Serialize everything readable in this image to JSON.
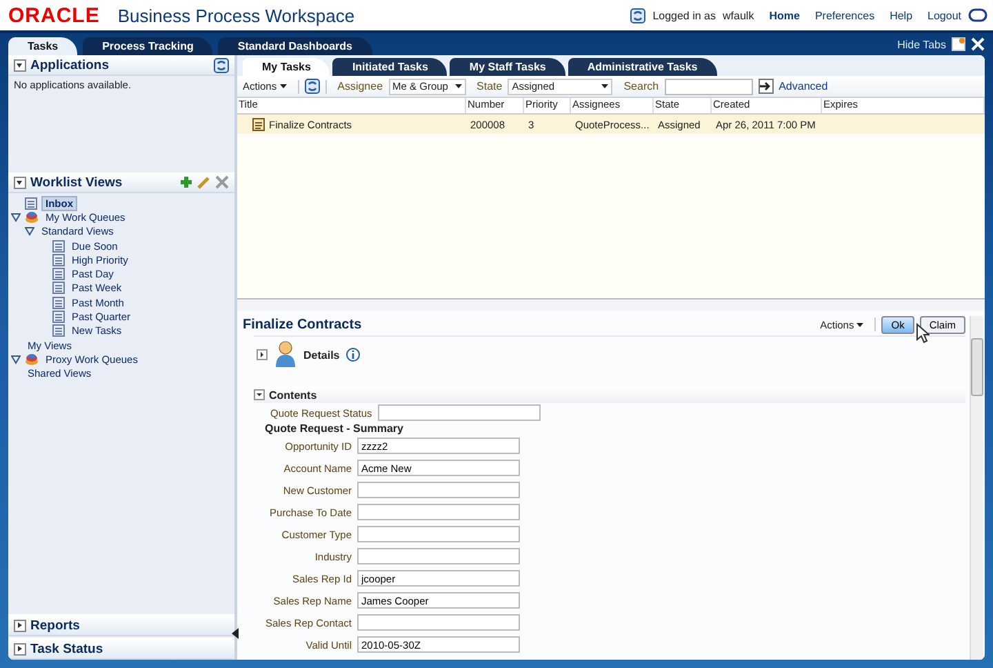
{
  "header": {
    "logo": "ORACLE",
    "app_title": "Business Process Workspace",
    "logged_in": "Logged in as",
    "user": "wfaulk",
    "links": [
      {
        "label": "Home",
        "selected": true
      },
      {
        "label": "Preferences",
        "selected": false
      },
      {
        "label": "Help",
        "selected": false
      },
      {
        "label": "Logout",
        "selected": false
      }
    ]
  },
  "top_tabs": [
    {
      "label": "Tasks",
      "selected": true
    },
    {
      "label": "Process Tracking",
      "selected": false
    },
    {
      "label": "Standard Dashboards",
      "selected": false
    }
  ],
  "hide_tabs": "Hide Tabs",
  "sidebar": {
    "applications": {
      "title": "Applications",
      "expanded": true,
      "message": "No applications available."
    },
    "worklist_views": {
      "title": "Worklist Views",
      "expanded": true,
      "tree": [
        {
          "label": "Inbox",
          "kind": "view",
          "selected": true
        },
        {
          "label": "My Work Queues",
          "kind": "queue",
          "selected": false,
          "expanded": true,
          "children": [
            {
              "label": "Standard Views",
              "kind": "folder",
              "selected": false,
              "expanded": true,
              "children": [
                {
                  "label": "Due Soon",
                  "kind": "view",
                  "selected": false
                },
                {
                  "label": "High Priority",
                  "kind": "view",
                  "selected": false
                },
                {
                  "label": "Past Day",
                  "kind": "view",
                  "selected": false
                },
                {
                  "label": "Past Week",
                  "kind": "view",
                  "selected": false
                },
                {
                  "label": "Past Month",
                  "kind": "view",
                  "selected": false
                },
                {
                  "label": "Past Quarter",
                  "kind": "view",
                  "selected": false
                },
                {
                  "label": "New Tasks",
                  "kind": "view",
                  "selected": false
                }
              ]
            },
            {
              "label": "My Views",
              "kind": "folder",
              "selected": false
            }
          ]
        },
        {
          "label": "Proxy Work Queues",
          "kind": "queue",
          "selected": false,
          "expanded": true,
          "children": [
            {
              "label": "Shared Views",
              "kind": "folder",
              "selected": false
            }
          ]
        }
      ]
    },
    "bottom_sections": [
      {
        "title": "Reports",
        "expanded": false
      },
      {
        "title": "Task Status",
        "expanded": false
      }
    ]
  },
  "sub_tabs": [
    {
      "label": "My Tasks",
      "selected": true
    },
    {
      "label": "Initiated Tasks",
      "selected": false
    },
    {
      "label": "My Staff Tasks",
      "selected": false
    },
    {
      "label": "Administrative Tasks",
      "selected": false
    }
  ],
  "toolbar": {
    "actions": "Actions",
    "assignee_label": "Assignee",
    "assignee": "Me & Group",
    "state_label": "State",
    "state": "Assigned",
    "search_label": "Search",
    "advanced": "Advanced"
  },
  "table": {
    "columns": [
      "Title",
      "Number",
      "Priority",
      "Assignees",
      "State",
      "Created",
      "Expires"
    ],
    "rows": [
      {
        "selected": true,
        "cells": [
          "Finalize Contracts",
          "200008",
          "3",
          "QuoteProcess...",
          "Assigned",
          "Apr 26, 2011 7:00 PM",
          ""
        ]
      }
    ]
  },
  "detail": {
    "title": "Finalize Contracts",
    "actions": "Actions",
    "buttons": [
      "Ok",
      "Claim"
    ],
    "details": {
      "title": "Details",
      "expanded": false
    },
    "contents": {
      "title": "Contents",
      "expanded": true
    },
    "status_field": {
      "label": "Quote Request Status"
    },
    "summary_title": "Quote Request - Summary",
    "fields": [
      {
        "label": "Opportunity ID",
        "value": "zzzz2"
      },
      {
        "label": "Account Name",
        "value": "Acme New"
      },
      {
        "label": "New Customer"
      },
      {
        "label": "Purchase To Date"
      },
      {
        "label": "Customer Type"
      },
      {
        "label": "Industry"
      },
      {
        "label": "Sales Rep Id",
        "value": "jcooper"
      },
      {
        "label": "Sales Rep Name",
        "value": "James Cooper"
      },
      {
        "label": "Sales Rep Contact"
      },
      {
        "label": "Valid Until",
        "value": "2010-05-30Z"
      }
    ]
  }
}
